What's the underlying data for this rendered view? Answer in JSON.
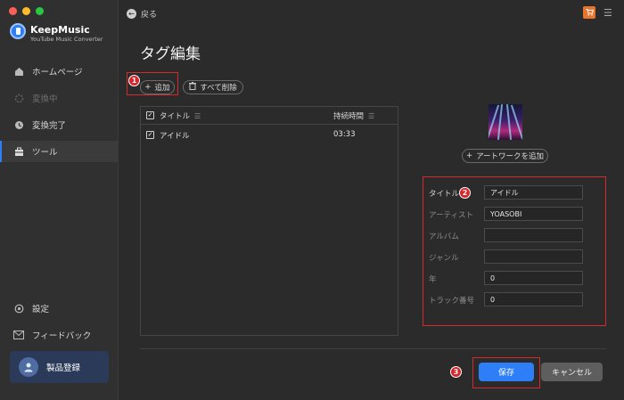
{
  "app": {
    "name": "KeepMusic",
    "subtitle": "YouTube Music Converter",
    "traffic_colors": [
      "#ff5f57",
      "#febc2e",
      "#28c840"
    ],
    "accent": "#2d7ef7",
    "highlight": "#d42a2a"
  },
  "sidebar": {
    "items": [
      {
        "label": "ホームページ",
        "icon": "home-icon"
      },
      {
        "label": "変換中",
        "icon": "spinner-icon"
      },
      {
        "label": "変換完了",
        "icon": "clock-icon"
      },
      {
        "label": "ツール",
        "icon": "toolbox-icon"
      }
    ],
    "bottom": [
      {
        "label": "設定",
        "icon": "gear-icon"
      },
      {
        "label": "フィードバック",
        "icon": "mail-icon"
      }
    ],
    "register_label": "製品登録"
  },
  "header": {
    "back_label": "戻る",
    "page_title": "タグ編集"
  },
  "toolbar": {
    "add_label": "追加",
    "delete_all_label": "すべて削除"
  },
  "table": {
    "columns": [
      "タイトル",
      "持続時間"
    ],
    "rows": [
      {
        "title": "アイドル",
        "duration": "03:33"
      }
    ]
  },
  "artwork": {
    "add_label": "アートワークを追加"
  },
  "form": {
    "title_label": "タイトル",
    "title_value": "アイドル",
    "artist_label": "アーティスト",
    "artist_value": "YOASOBI",
    "album_label": "アルバム",
    "album_value": "",
    "genre_label": "ジャンル",
    "genre_value": "",
    "year_label": "年",
    "year_value": "0",
    "track_label": "トラック番号",
    "track_value": "0"
  },
  "footer": {
    "save_label": "保存",
    "cancel_label": "キャンセル"
  },
  "badges": [
    "1",
    "2",
    "3"
  ]
}
